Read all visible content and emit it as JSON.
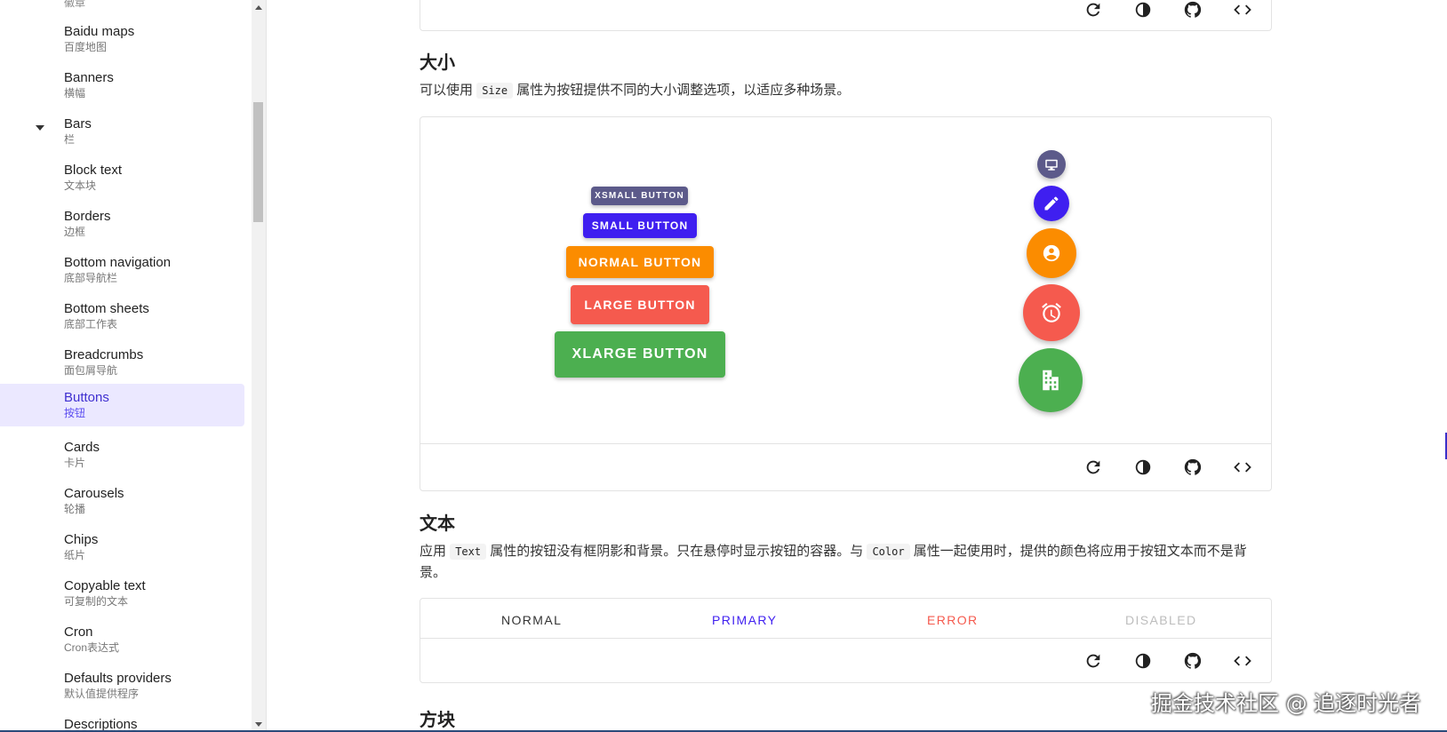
{
  "sidebar": {
    "partial_top_sub": "徽章",
    "items": [
      {
        "title": "Baidu maps",
        "sub": "百度地图"
      },
      {
        "title": "Banners",
        "sub": "横幅"
      },
      {
        "title": "Bars",
        "sub": "栏"
      },
      {
        "title": "Block text",
        "sub": "文本块"
      },
      {
        "title": "Borders",
        "sub": "边框"
      },
      {
        "title": "Bottom navigation",
        "sub": "底部导航栏"
      },
      {
        "title": "Bottom sheets",
        "sub": "底部工作表"
      },
      {
        "title": "Breadcrumbs",
        "sub": "面包屑导航"
      },
      {
        "title": "Buttons",
        "sub": "按钮"
      },
      {
        "title": "Cards",
        "sub": "卡片"
      },
      {
        "title": "Carousels",
        "sub": "轮播"
      },
      {
        "title": "Chips",
        "sub": "纸片"
      },
      {
        "title": "Copyable text",
        "sub": "可复制的文本"
      },
      {
        "title": "Cron",
        "sub": "Cron表达式"
      },
      {
        "title": "Defaults providers",
        "sub": "默认值提供程序"
      },
      {
        "title": "Descriptions",
        "sub": ""
      }
    ],
    "active_item": "Buttons",
    "expanded_item": "Bars"
  },
  "size_section": {
    "title": "大小",
    "desc_before": "可以使用",
    "desc_code": "Size",
    "desc_after": "属性为按钮提供不同的大小调整选项，以适应多种场景。",
    "buttons": {
      "xsmall": "XSMALL BUTTON",
      "small": "SMALL BUTTON",
      "normal": "NORMAL BUTTON",
      "large": "LARGE BUTTON",
      "xlarge": "XLARGE BUTTON"
    },
    "fab_icons": [
      "monitor-icon",
      "pencil-icon",
      "account-circle-icon",
      "alarm-icon",
      "office-building-icon"
    ]
  },
  "text_section": {
    "title": "文本",
    "desc_1": "应用",
    "desc_code_1": "Text",
    "desc_2": "属性的按钮没有框阴影和背景。只在悬停时显示按钮的容器。与",
    "desc_code_2": "Color",
    "desc_3": "属性一起使用时，提供的颜色将应用于按钮文本而不是背景。",
    "buttons": {
      "normal": "NORMAL",
      "primary": "PRIMARY",
      "error": "ERROR",
      "disabled": "DISABLED"
    }
  },
  "block_section": {
    "title": "方块"
  },
  "toolbar_icons": [
    "refresh-icon",
    "theme-contrast-icon",
    "github-icon",
    "code-icon"
  ],
  "watermark": "掘金技术社区 @ 追逐时光者",
  "colors": {
    "primary": "#3f1ff0",
    "xsmall": "#5c5a8a",
    "orange": "#fb8c00",
    "red": "#f55a4e",
    "green": "#4caf50",
    "disabled": "#bdbdbd"
  }
}
